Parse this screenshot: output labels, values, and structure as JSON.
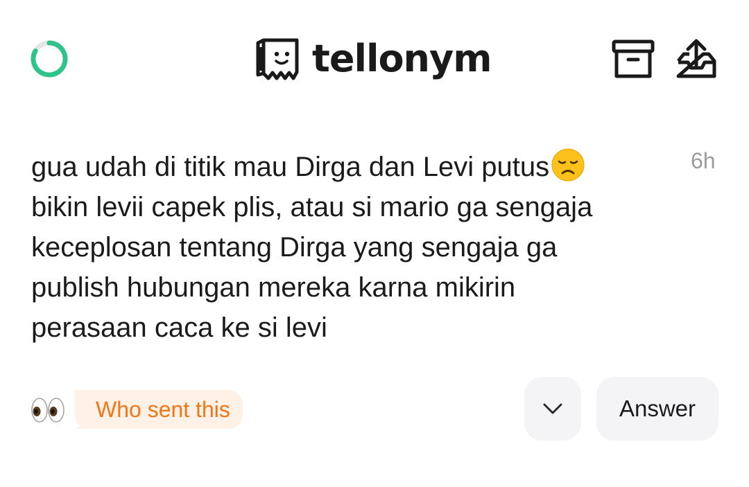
{
  "header": {
    "brand_name": "tellonym",
    "icons": {
      "status": "loading-ring-icon",
      "logo": "tellonym-logo-icon",
      "archive": "archive-box-icon",
      "share": "share-export-icon"
    }
  },
  "tell": {
    "message_lines": [
      "gua udah di titik mau Dirga dan Levi putus",
      "bikin levii capek plis, atau si mario ga sengaja",
      "keceplosan tentang Dirga yang sengaja ga",
      "publish hubungan mereka karna mikirin",
      "perasaan caca ke si levi"
    ],
    "emoji": "disappointed-face",
    "time": "6h"
  },
  "footer": {
    "eyes_icon": "eyes-emoji-icon",
    "who_sent_label": "Who sent this",
    "expand_icon": "chevron-down-icon",
    "answer_label": "Answer"
  },
  "colors": {
    "accent_green": "#2ec38a",
    "who_text": "#f07618",
    "who_bg": "#fff1e6",
    "button_bg": "#f4f4f6",
    "time_gray": "#9b9b9b"
  }
}
